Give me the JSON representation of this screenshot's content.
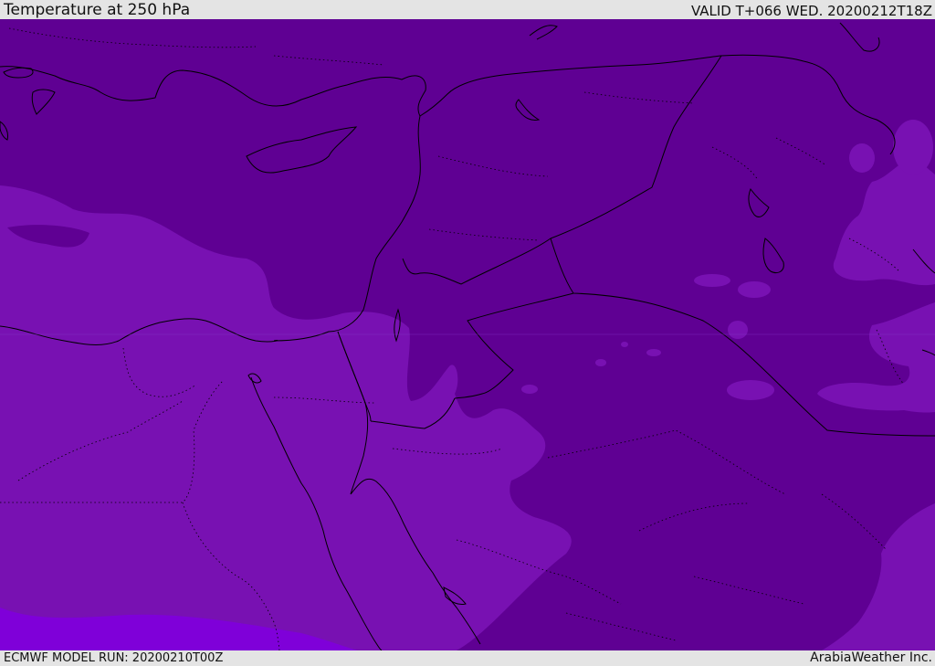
{
  "header": {
    "title": "Temperature at 250 hPa",
    "valid_time": "VALID T+066 WED. 20200212T18Z"
  },
  "footer": {
    "model_run": "ECMWF MODEL RUN: 20200210T00Z",
    "credit": "ArabiaWeather Inc."
  },
  "map": {
    "field": "temperature",
    "level": "250 hPa",
    "colors": {
      "cold_dark": "#5f0093",
      "cool": "#7811b2",
      "warmer": "#7f00d9",
      "coastline": "#000000"
    }
  }
}
